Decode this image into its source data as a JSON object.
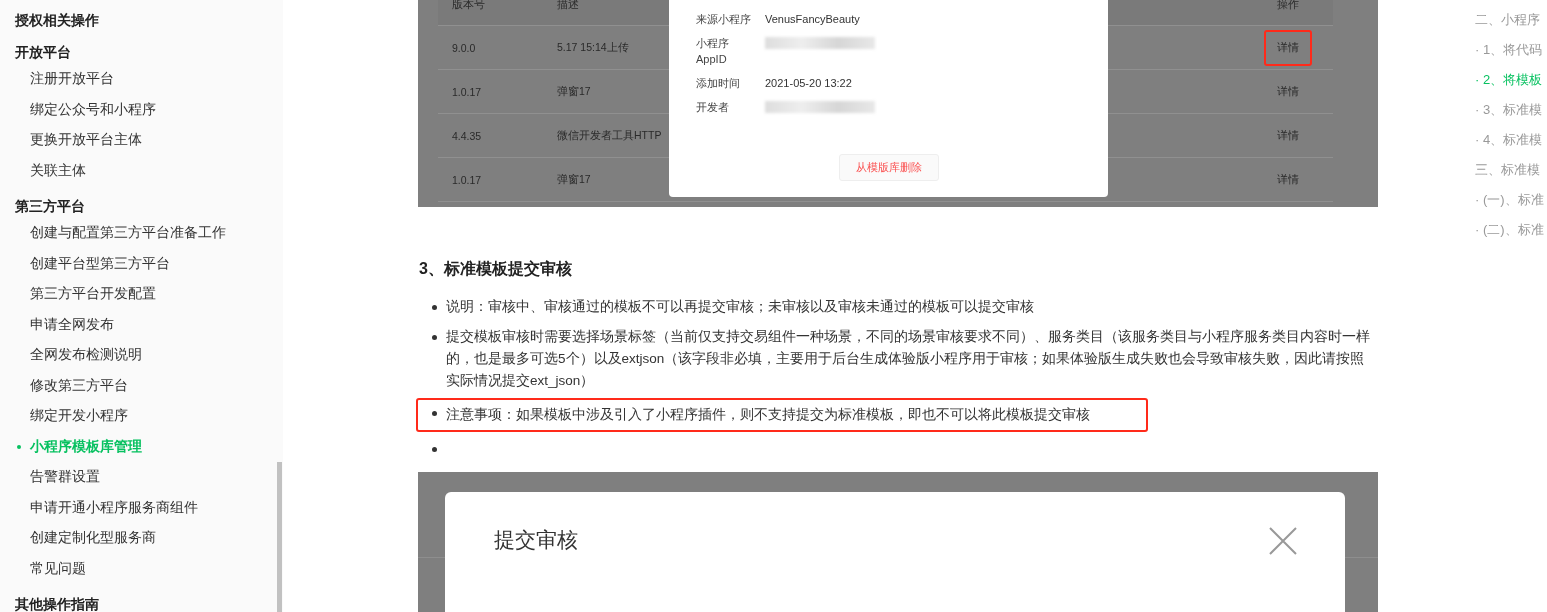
{
  "sidebar": {
    "groups": [
      {
        "title": "授权相关操作"
      },
      {
        "title": "开放平台",
        "items": [
          {
            "label": "注册开放平台",
            "selected": false
          },
          {
            "label": "绑定公众号和小程序",
            "selected": false
          },
          {
            "label": "更换开放平台主体",
            "selected": false
          },
          {
            "label": "关联主体",
            "selected": false
          }
        ]
      },
      {
        "title": "第三方平台",
        "items": [
          {
            "label": "创建与配置第三方平台准备工作",
            "selected": false
          },
          {
            "label": "创建平台型第三方平台",
            "selected": false
          },
          {
            "label": "第三方平台开发配置",
            "selected": false
          },
          {
            "label": "申请全网发布",
            "selected": false
          },
          {
            "label": "全网发布检测说明",
            "selected": false
          },
          {
            "label": "修改第三方平台",
            "selected": false
          },
          {
            "label": "绑定开发小程序",
            "selected": false
          },
          {
            "label": "小程序模板库管理",
            "selected": true
          },
          {
            "label": "告警群设置",
            "selected": false
          },
          {
            "label": "申请开通小程序服务商组件",
            "selected": false
          },
          {
            "label": "创建定制化型服务商",
            "selected": false
          },
          {
            "label": "常见问题",
            "selected": false
          }
        ]
      },
      {
        "title": "其他操作指南"
      }
    ]
  },
  "figure_1": {
    "table": {
      "columns": [
        "版本号",
        "描述",
        "操作"
      ],
      "rows": [
        {
          "version": "9.0.0",
          "description": "5.17 15:14上传",
          "action": "详情",
          "highlighted": true
        },
        {
          "version": "1.0.17",
          "description": "弹窗17",
          "action": "详情",
          "highlighted": false
        },
        {
          "version": "4.4.35",
          "description": "微信开发者工具HTTP",
          "action": "详情",
          "highlighted": false
        },
        {
          "version": "1.0.17",
          "description": "弹窗17",
          "action": "详情",
          "highlighted": false
        }
      ]
    },
    "modal": {
      "fields": [
        {
          "label": "来源小程序",
          "kind": "text",
          "value": "VenusFancyBeauty"
        },
        {
          "label": "小程序 AppID",
          "kind": "blurred"
        },
        {
          "label": "添加时间",
          "kind": "text",
          "value": "2021-05-20 13:22"
        },
        {
          "label": "开发者",
          "kind": "blurred"
        }
      ],
      "delete_button": "从模版库删除"
    }
  },
  "section": {
    "heading": "3、标准模板提交审核",
    "bullets": [
      {
        "kind": "text",
        "text": "说明：审核中、审核通过的模板不可以再提交审核；未审核以及审核未通过的模板可以提交审核",
        "highlighted": false
      },
      {
        "kind": "text",
        "text": "提交模板审核时需要选择场景标签（当前仅支持交易组件一种场景，不同的场景审核要求不同）、服务类目（该服务类目与小程序服务类目内容时一样的，也是最多可选5个）以及extjson（该字段非必填，主要用于后台生成体验版小程序用于审核；如果体验版生成失败也会导致审核失败，因此请按照实际情况提交ext_json）",
        "highlighted": false
      },
      {
        "kind": "text",
        "text": "注意事项：如果模板中涉及引入了小程序插件，则不支持提交为标准模板，即也不可以将此模板提交审核",
        "highlighted": true
      },
      {
        "kind": "empty",
        "highlighted": false
      }
    ]
  },
  "figure_2": {
    "dialog_title": "提交审核"
  },
  "toc": {
    "items": [
      {
        "label": "二、小程序",
        "selected": false
      },
      {
        "label": "· 1、将代码",
        "selected": false
      },
      {
        "label": "· 2、将模板",
        "selected": true
      },
      {
        "label": "· 3、标准模",
        "selected": false
      },
      {
        "label": "· 4、标准模",
        "selected": false
      },
      {
        "label": "三、标准模",
        "selected": false
      },
      {
        "label": "· (一)、标准",
        "selected": false
      },
      {
        "label": "· (二)、标准",
        "selected": false
      }
    ]
  }
}
